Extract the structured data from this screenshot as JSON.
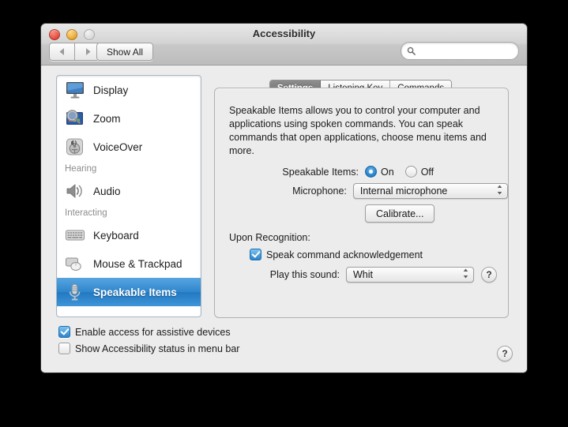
{
  "window": {
    "title": "Accessibility",
    "traffic_lights": [
      "close",
      "minimize",
      "zoom"
    ]
  },
  "toolbar": {
    "back_label": "◀",
    "forward_label": "▶",
    "show_all_label": "Show All",
    "search_placeholder": "",
    "search_value": "",
    "search_icon": "search-icon"
  },
  "sidebar": {
    "items": [
      {
        "label": "Display",
        "icon": "display-icon",
        "type": "item",
        "selected": false
      },
      {
        "label": "Zoom",
        "icon": "zoom-icon",
        "type": "item",
        "selected": false
      },
      {
        "label": "VoiceOver",
        "icon": "voiceover-icon",
        "type": "item",
        "selected": false
      },
      {
        "label": "Hearing",
        "type": "header"
      },
      {
        "label": "Audio",
        "icon": "audio-icon",
        "type": "item",
        "selected": false
      },
      {
        "label": "Interacting",
        "type": "header"
      },
      {
        "label": "Keyboard",
        "icon": "keyboard-icon",
        "type": "item",
        "selected": false
      },
      {
        "label": "Mouse & Trackpad",
        "icon": "mouse-trackpad-icon",
        "type": "item",
        "selected": false
      },
      {
        "label": "Speakable Items",
        "icon": "microphone-icon",
        "type": "item",
        "selected": true
      }
    ]
  },
  "panel": {
    "tabs": [
      {
        "label": "Settings",
        "active": true
      },
      {
        "label": "Listening Key",
        "active": false
      },
      {
        "label": "Commands",
        "active": false
      }
    ],
    "description": "Speakable Items allows you to control your computer and applications using spoken commands. You can speak commands that open applications, choose menu items and more.",
    "speakable_items": {
      "label": "Speakable Items:",
      "on_label": "On",
      "off_label": "Off",
      "value": "On"
    },
    "microphone": {
      "label": "Microphone:",
      "value": "Internal microphone"
    },
    "calibrate_label": "Calibrate...",
    "upon_recognition": {
      "label": "Upon Recognition:",
      "speak_ack_label": "Speak command acknowledgement",
      "speak_ack_checked": true,
      "play_sound_label": "Play this sound:",
      "play_sound_value": "Whit",
      "help_label": "?"
    }
  },
  "footer": {
    "assistive_label": "Enable access for assistive devices",
    "assistive_checked": true,
    "menubar_label": "Show Accessibility status in menu bar",
    "menubar_checked": false,
    "help_label": "?"
  },
  "colors": {
    "selection_blue": "#2f86cc",
    "window_bg": "#ececec",
    "desktop": "#000000"
  }
}
